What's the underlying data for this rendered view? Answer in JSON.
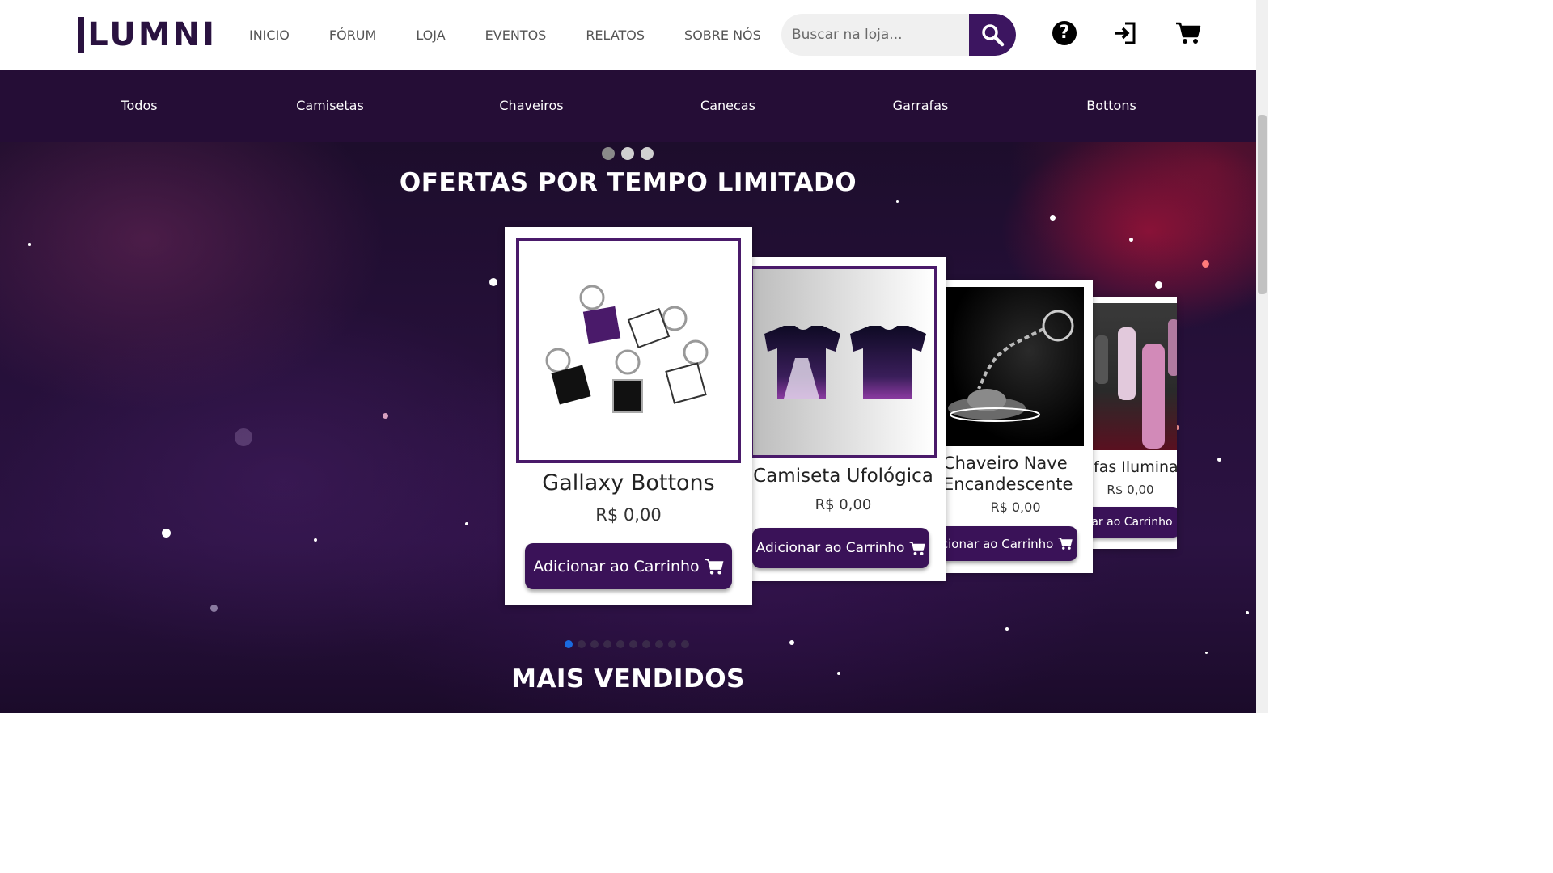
{
  "brand": {
    "name": "LUMNI"
  },
  "nav": {
    "items": [
      "INICIO",
      "FÓRUM",
      "LOJA",
      "EVENTOS",
      "RELATOS",
      "SOBRE NÓS"
    ]
  },
  "search": {
    "placeholder": "Buscar na loja...",
    "value": ""
  },
  "header_icons": [
    "help-icon",
    "login-icon",
    "cart-icon"
  ],
  "categories": [
    "Todos",
    "Camisetas",
    "Chaveiros",
    "Canecas",
    "Garrafas",
    "Bottons"
  ],
  "offers": {
    "title": "OFERTAS POR TEMPO LIMITADO",
    "products": [
      {
        "name": "Gallaxy Bottons",
        "price": "R$ 0,00",
        "button": "Adicionar ao Carrinho"
      },
      {
        "name": "Camiseta Ufológica",
        "price": "R$ 0,00",
        "button": "Adicionar ao Carrinho"
      },
      {
        "name": "Chaveiro Nave Encandescente",
        "name_line1": "Chaveiro Nave",
        "name_line2": "Encandescente",
        "price": "R$ 0,00",
        "button": "icionar ao Carrinho"
      },
      {
        "name": "fas Iluminad",
        "price": "R$ 0,00",
        "button": "nar ao Carrinho"
      }
    ],
    "pager": {
      "count": 10,
      "active": 0
    }
  },
  "best_sellers": {
    "title": "MAIS VENDIDOS"
  },
  "colors": {
    "primary": "#3a1258",
    "category_bar": "#250d36",
    "accent_dot": "#1a6adf"
  }
}
